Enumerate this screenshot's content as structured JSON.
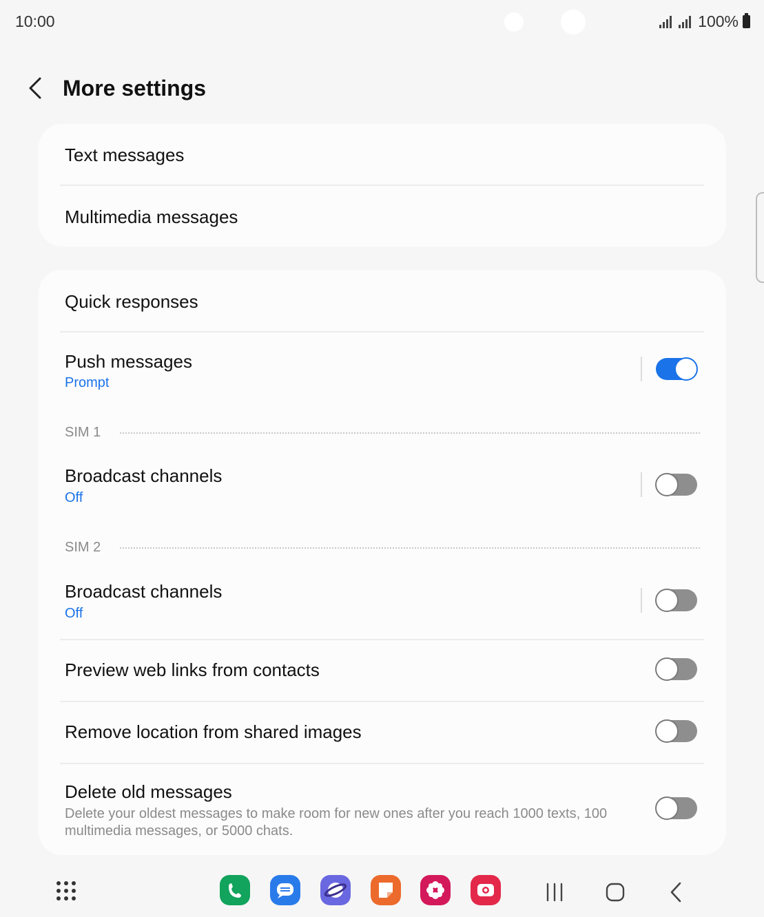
{
  "status_bar": {
    "time": "10:00",
    "battery_text": "100%"
  },
  "header": {
    "title": "More settings",
    "back_icon": "chevron-left-icon"
  },
  "group1": {
    "items": [
      {
        "label": "Text messages"
      },
      {
        "label": "Multimedia messages"
      }
    ]
  },
  "group2": {
    "quick_responses": {
      "label": "Quick responses"
    },
    "push_messages": {
      "label": "Push messages",
      "sub": "Prompt",
      "enabled": true
    },
    "sim1": {
      "section": "SIM 1",
      "broadcast": {
        "label": "Broadcast channels",
        "sub": "Off",
        "enabled": false
      }
    },
    "sim2": {
      "section": "SIM 2",
      "broadcast": {
        "label": "Broadcast channels",
        "sub": "Off",
        "enabled": false
      }
    },
    "preview_links": {
      "label": "Preview web links from contacts",
      "enabled": false
    },
    "remove_location": {
      "label": "Remove location from shared images",
      "enabled": false
    },
    "delete_old": {
      "label": "Delete old messages",
      "desc": "Delete your oldest messages to make room for new ones after you reach 1000 texts, 100 multimedia messages, or 5000 chats.",
      "enabled": false
    }
  },
  "colors": {
    "accent": "#1a73e8",
    "toggle_off": "#8e8e8e",
    "background": "#f6f6f6",
    "card": "#fcfcfc"
  },
  "dock": {
    "apps": [
      {
        "name": "phone",
        "icon": "phone-icon",
        "color": "#12a35c"
      },
      {
        "name": "messages",
        "icon": "messages-icon",
        "color": "#2a7bea"
      },
      {
        "name": "internet",
        "icon": "internet-icon",
        "color": "#6a68e0"
      },
      {
        "name": "notes",
        "icon": "notes-icon",
        "color": "#ec6a2c"
      },
      {
        "name": "gallery",
        "icon": "gallery-icon",
        "color": "#d4195a"
      },
      {
        "name": "camera",
        "icon": "camera-icon",
        "color": "#e3284a"
      }
    ]
  }
}
